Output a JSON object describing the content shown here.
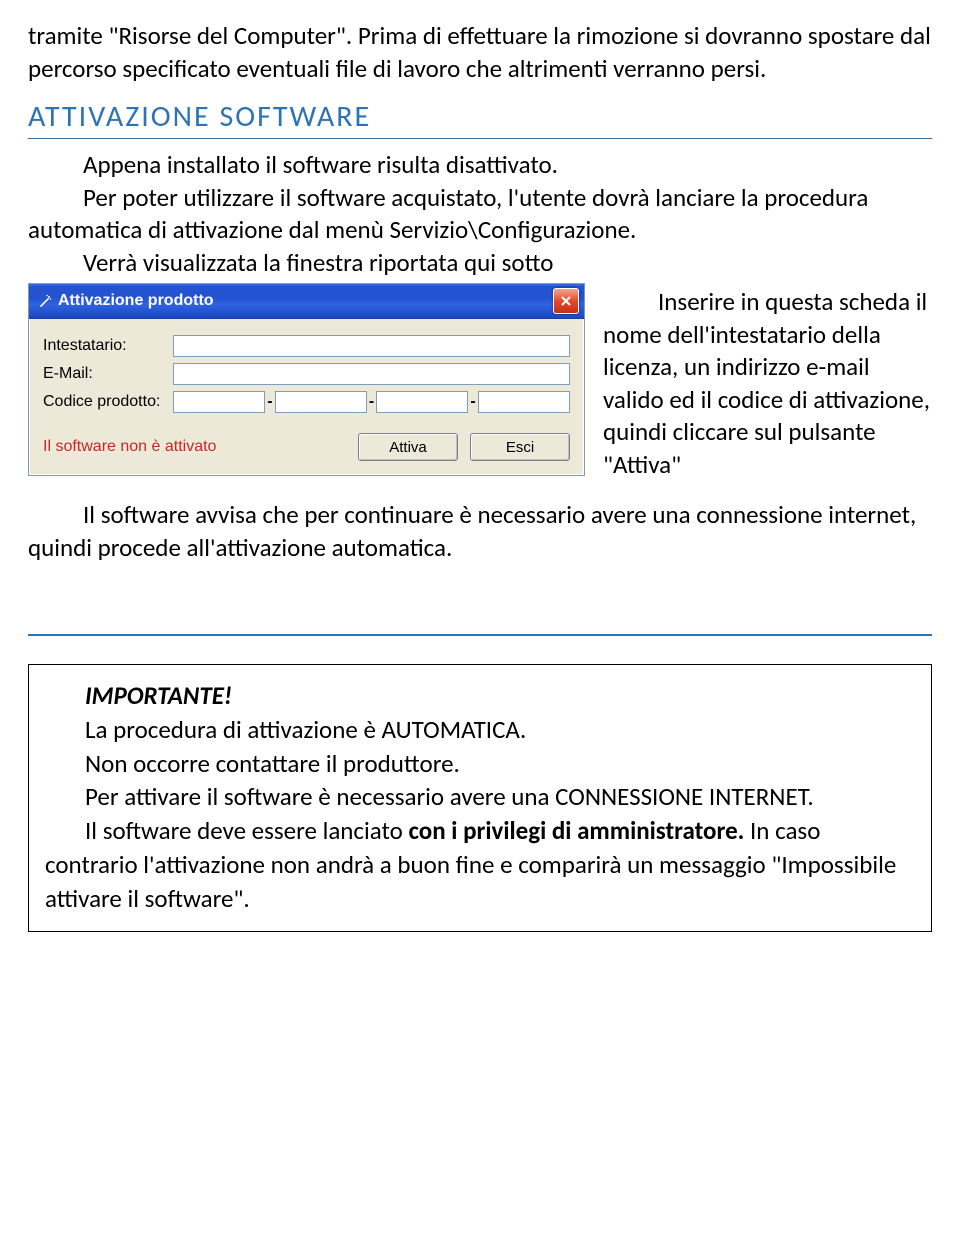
{
  "intro": {
    "p1": "tramite \"Risorse del Computer\". Prima di effettuare la rimozione si dovranno spostare dal percorso specificato eventuali file di lavoro che altrimenti verranno persi."
  },
  "section": {
    "heading": "ATTIVAZIONE SOFTWARE",
    "p2a": "Appena installato il software risulta disattivato.",
    "p2b": "Per poter utilizzare il software acquistato, l'utente dovrà lanciare la procedura automatica di attivazione dal menù Servizio\\Configurazione.",
    "p2c": "Verrà visualizzata la finestra riportata qui sotto"
  },
  "dialog": {
    "title": "Attivazione prodotto",
    "labels": {
      "intestatario": "Intestatario:",
      "email": "E-Mail:",
      "codice": "Codice prodotto:"
    },
    "status": "Il software non è attivato",
    "buttons": {
      "attiva": "Attiva",
      "esci": "Esci"
    }
  },
  "sideText": "Inserire in questa scheda il nome dell'intestatario della licenza, un indirizzo e-mail valido ed il codice di attivazione, quindi cliccare sul pulsante \"Attiva\"",
  "p3": "Il software avvisa che per continuare è necessario avere una connessione internet, quindi procede all'attivazione automatica.",
  "note": {
    "title": "IMPORTANTE!",
    "l1": "La procedura di attivazione è AUTOMATICA.",
    "l2": "Non occorre contattare il produttore.",
    "l3a": "Per attivare il software è necessario avere una CONNESSIONE INTERNET.",
    "l4a": "Il software deve essere lanciato ",
    "l4b": "con i privilegi di amministratore.",
    "l4c": " In caso contrario l'attivazione non andrà a buon fine e comparirà un messaggio \"Impossibile attivare il software\"."
  }
}
